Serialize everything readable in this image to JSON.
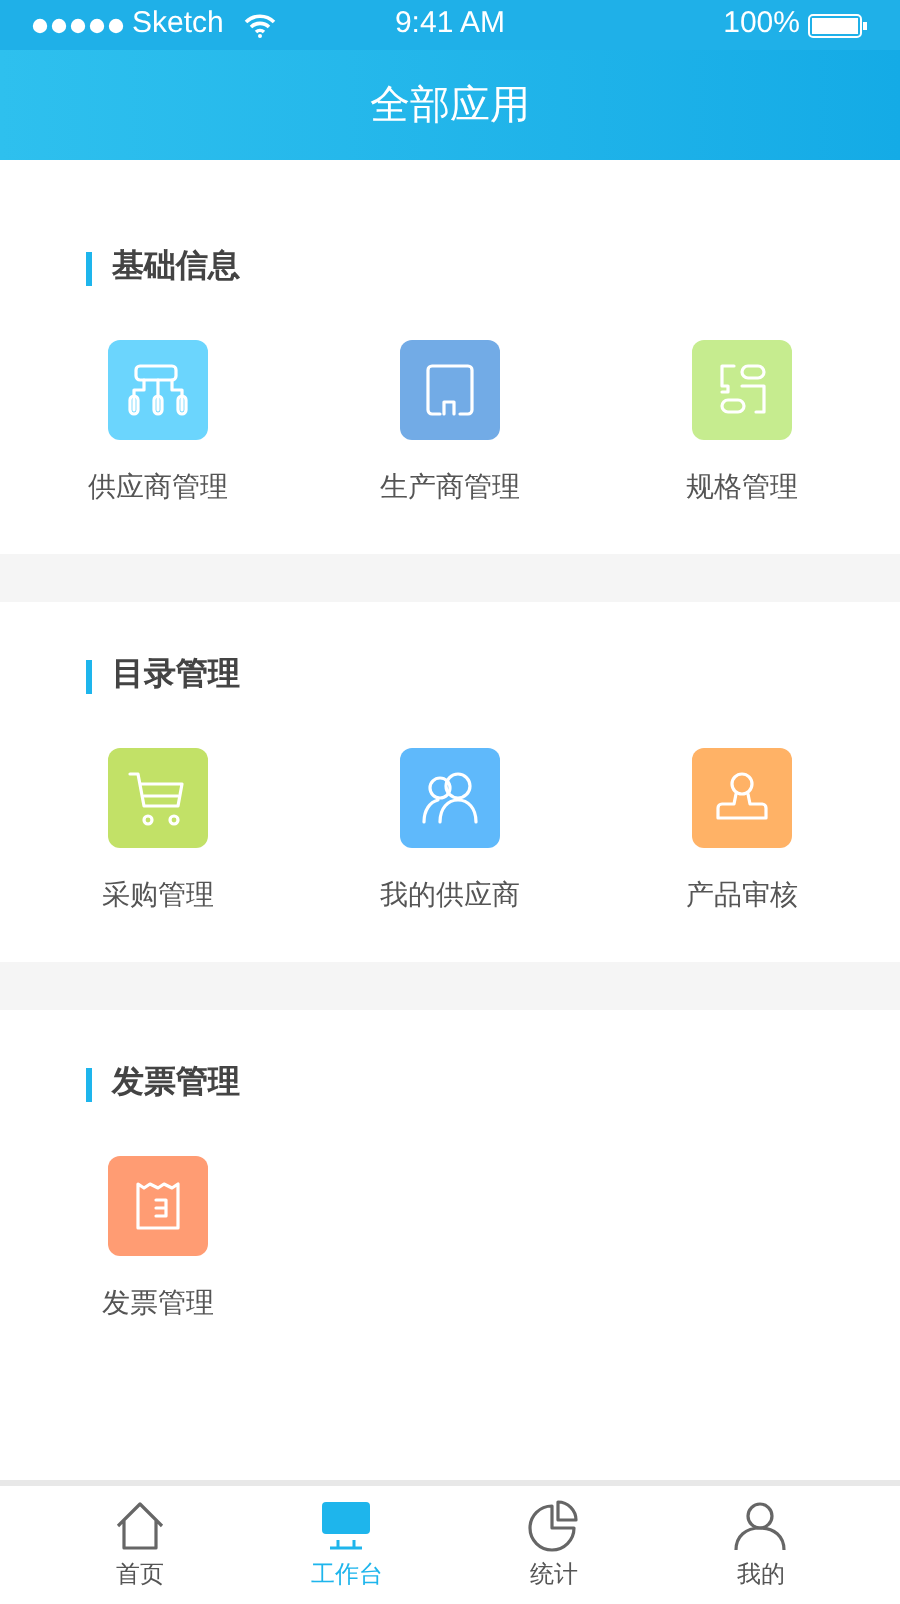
{
  "status_bar": {
    "carrier": "Sketch",
    "time": "9:41 AM",
    "battery": "100%"
  },
  "header": {
    "title": "全部应用"
  },
  "sections": [
    {
      "title": "基础信息",
      "apps": [
        {
          "label": "供应商管理",
          "kind": "org",
          "color": "#6bd5fd"
        },
        {
          "label": "生产商管理",
          "kind": "factory",
          "color": "#72abe6"
        },
        {
          "label": "规格管理",
          "kind": "grid",
          "color": "#c6ec8f"
        }
      ]
    },
    {
      "title": "目录管理",
      "apps": [
        {
          "label": "采购管理",
          "kind": "cart",
          "color": "#c2e167"
        },
        {
          "label": "我的供应商",
          "kind": "people",
          "color": "#5fb9fb"
        },
        {
          "label": "产品审核",
          "kind": "stamp",
          "color": "#ffb266"
        }
      ]
    },
    {
      "title": "发票管理",
      "apps": [
        {
          "label": "发票管理",
          "kind": "receipt",
          "color": "#ff9c73"
        }
      ]
    }
  ],
  "tab_bar": [
    {
      "label": "首页",
      "kind": "home",
      "selected": false
    },
    {
      "label": "工作台",
      "kind": "desk",
      "selected": true
    },
    {
      "label": "统计",
      "kind": "pie",
      "selected": false
    },
    {
      "label": "我的",
      "kind": "user",
      "selected": false
    }
  ]
}
